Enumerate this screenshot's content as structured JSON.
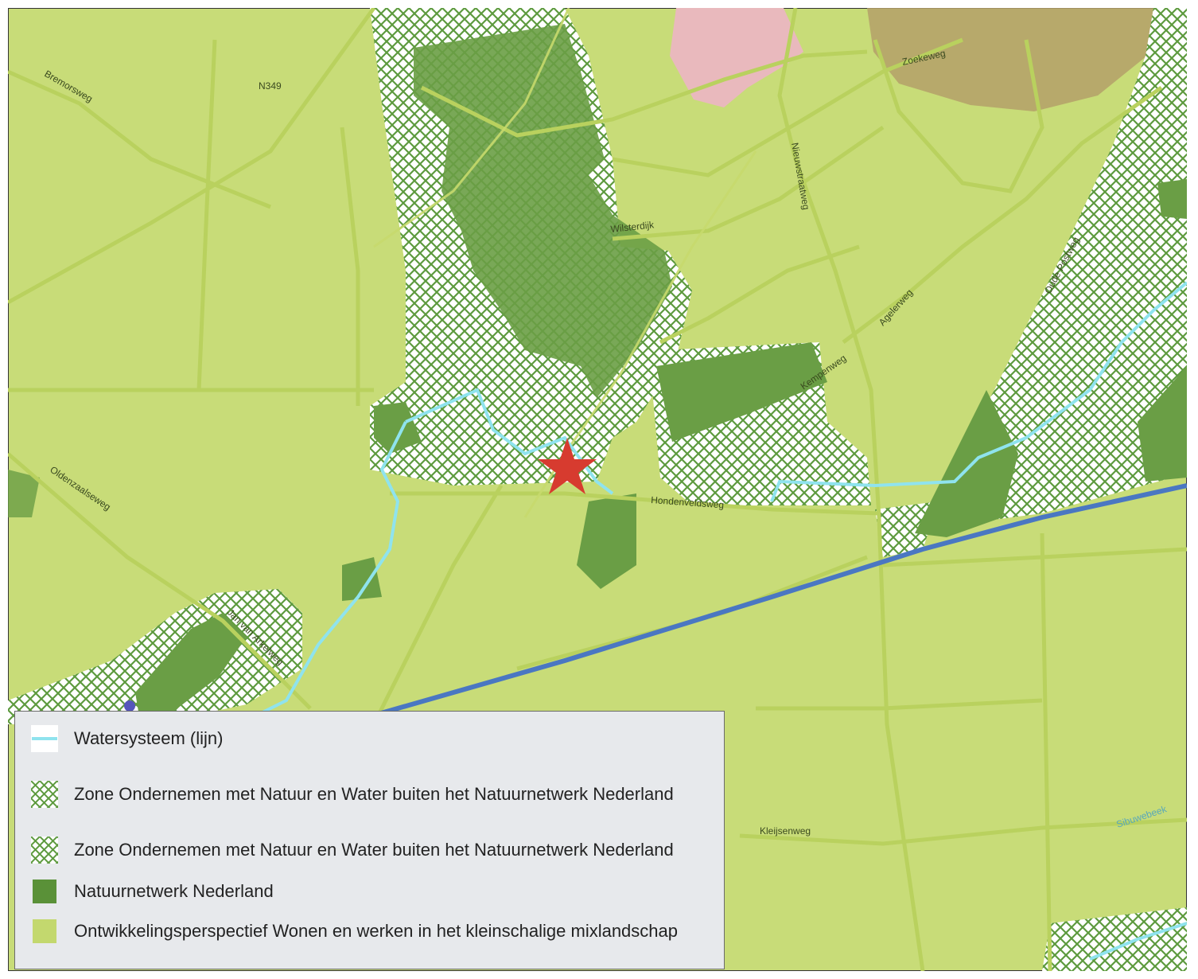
{
  "map": {
    "road_labels": {
      "bremorsweg": "Bremorsweg",
      "n349": "N349",
      "zoekeweg": "Zoekeweg",
      "nieuwstraatweg": "Nieuwstraatweg",
      "wilsterdijk": "Wilsterdijk",
      "agelerweg": "Agelerweg",
      "oude_postweg": "Oude Postweg",
      "kempenweg": "Kempenweg",
      "oldenzaalseweg": "Oldenzaalseweg",
      "hondenveldsweg": "Hondenveldsweg",
      "van_arkelweg": "Jan van Arkelweg",
      "kleijsenweg": "Kleijsenweg",
      "sibuwebeek": "Sibuwebeek"
    },
    "marker": {
      "symbol": "star",
      "color": "#d73b2f"
    },
    "colors": {
      "mixlandschap": "#c8dc78",
      "natuurnetwerk": "#6a9e45",
      "water": "#8fe3ee",
      "canal": "#4a77c2",
      "urban_pink": "#e9b9bd",
      "brown_zone": "#b4a068"
    }
  },
  "legend": {
    "items": [
      {
        "label": "Watersysteem (lijn)",
        "symbol": "water-line"
      },
      {
        "label": "Zone Ondernemen met Natuur en Water buiten het Natuurnetwerk Nederland",
        "symbol": "hatch"
      },
      {
        "label": "Zone Ondernemen met Natuur en Water buiten het Natuurnetwerk Nederland",
        "symbol": "hatch"
      },
      {
        "label": "Natuurnetwerk Nederland",
        "symbol": "dark-green-fill"
      },
      {
        "label": "Ontwikkelingsperspectief Wonen en werken in het kleinschalige mixlandschap",
        "symbol": "light-green-fill"
      }
    ]
  }
}
